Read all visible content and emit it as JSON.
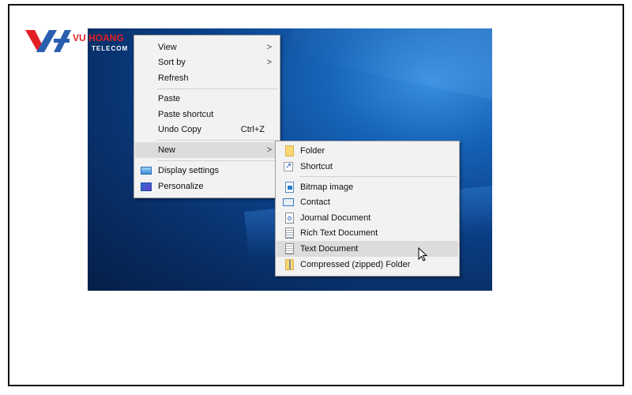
{
  "logo": {
    "brand": "VU HOANG",
    "sub": "TELECOM",
    "colors": {
      "red": "#e41e26",
      "blue": "#2a5fb0"
    }
  },
  "context_menu": {
    "items": [
      {
        "label": "View",
        "submenu": true
      },
      {
        "label": "Sort by",
        "submenu": true
      },
      {
        "label": "Refresh"
      },
      {
        "label": "Paste"
      },
      {
        "label": "Paste shortcut"
      },
      {
        "label": "Undo Copy",
        "shortcut": "Ctrl+Z"
      },
      {
        "label": "New",
        "submenu": true,
        "highlighted": true
      },
      {
        "label": "Display settings",
        "icon": "display-icon"
      },
      {
        "label": "Personalize",
        "icon": "personalize-icon"
      }
    ],
    "arrow": ">"
  },
  "new_submenu": {
    "items": [
      {
        "label": "Folder",
        "icon": "folder-icon"
      },
      {
        "label": "Shortcut",
        "icon": "shortcut-icon"
      },
      {
        "label": "Bitmap image",
        "icon": "bitmap-icon"
      },
      {
        "label": "Contact",
        "icon": "contact-icon"
      },
      {
        "label": "Journal Document",
        "icon": "journal-icon"
      },
      {
        "label": "Rich Text Document",
        "icon": "rich-text-icon"
      },
      {
        "label": "Text Document",
        "icon": "text-document-icon",
        "highlighted": true
      },
      {
        "label": "Compressed (zipped) Folder",
        "icon": "zip-folder-icon"
      }
    ]
  }
}
